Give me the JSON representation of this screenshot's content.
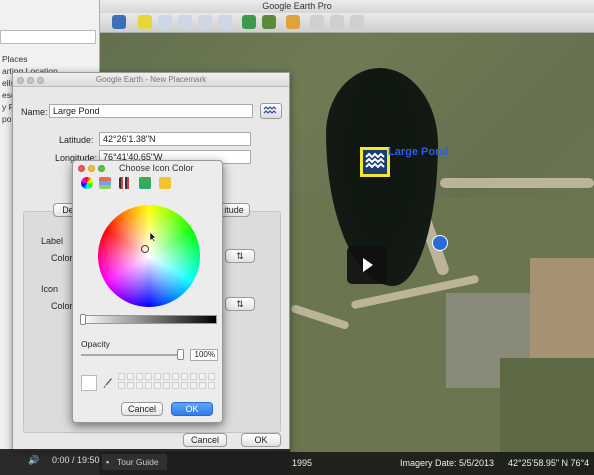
{
  "window": {
    "title": "Google Earth Pro"
  },
  "sidebar": {
    "items": [
      "Places",
      "arting Location",
      "ells",
      "esou",
      "y Fa",
      "pon"
    ]
  },
  "placemark_dialog": {
    "title": "Google Earth - New Placemark",
    "name_label": "Name:",
    "name_value": "Large Pond",
    "latitude_label": "Latitude:",
    "latitude_value": "42°26'1.38\"N",
    "longitude_label": "Longitude:",
    "longitude_value": "76°41'40.65\"W",
    "tab_left": "De",
    "tab_right": "itude",
    "label_section": "Label",
    "label_color": "Color",
    "icon_section": "Icon",
    "icon_color": "Color",
    "cancel": "Cancel",
    "ok": "OK"
  },
  "color_picker": {
    "title": "Choose Icon Color",
    "opacity_label": "Opacity",
    "opacity_value": "100%",
    "opacity_level": 1.0,
    "cancel": "Cancel",
    "ok": "OK"
  },
  "map": {
    "placemark_label": "Large Pond"
  },
  "status_bar": {
    "year": "1995",
    "imagery": "Imagery Date: 5/5/2013",
    "coords": "42°25'58.95\" N   76°4"
  },
  "video": {
    "time": "0:00 / 19:50",
    "tour_guide": "Tour Guide"
  },
  "colors": {
    "accent": "#2f7ce8",
    "placemark_border": "#f2e92e",
    "label_blue": "#2e5ce6"
  },
  "icons": [
    "sidebar-toggle-icon",
    "add-placemark-icon",
    "add-polygon-icon",
    "add-path-icon",
    "add-overlay-icon",
    "record-tour-icon",
    "historical-imagery-icon",
    "sunlight-icon",
    "planets-icon",
    "ruler-icon",
    "email-icon",
    "print-icon"
  ]
}
